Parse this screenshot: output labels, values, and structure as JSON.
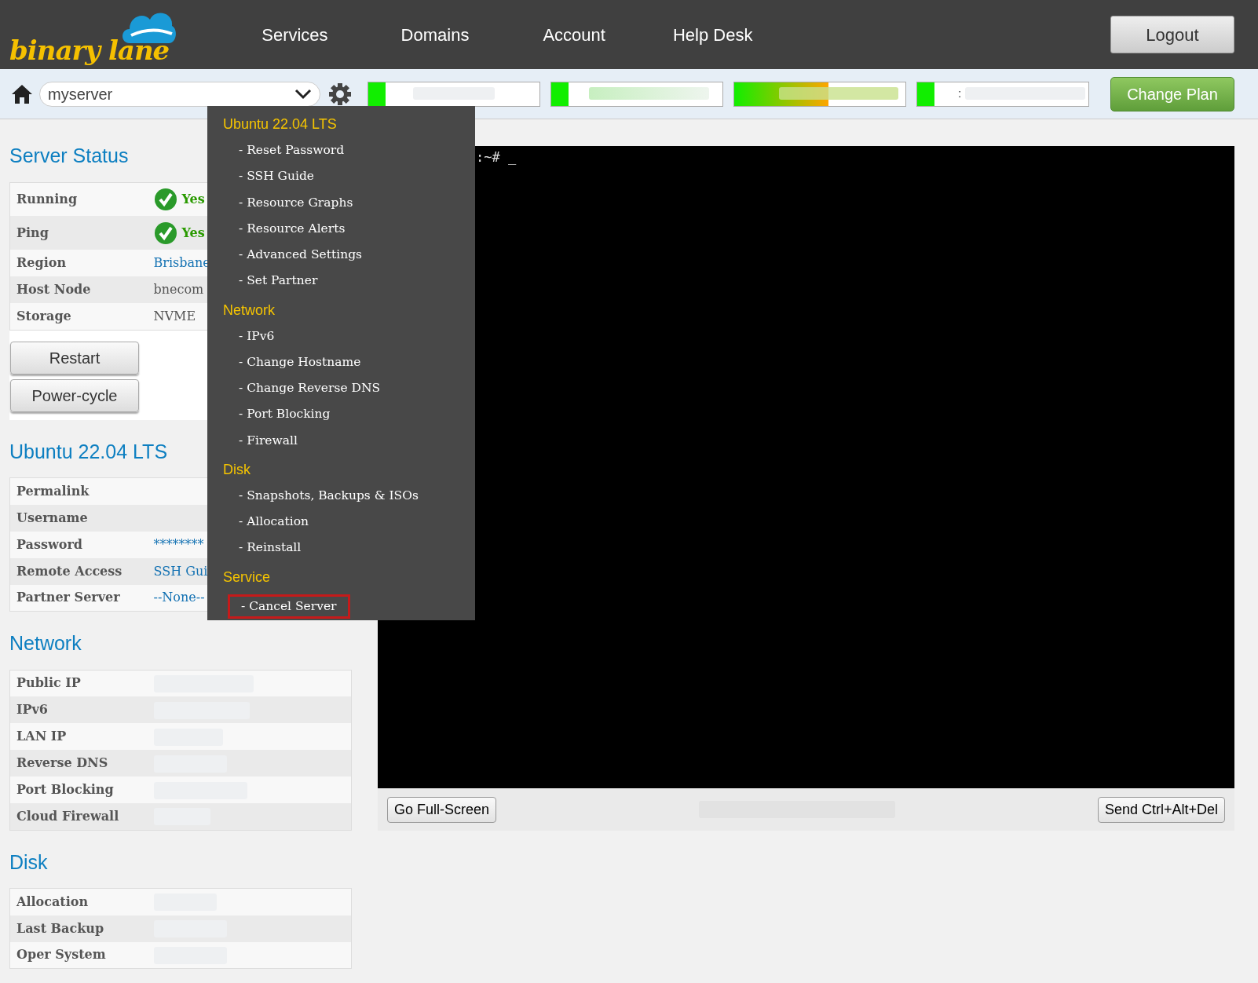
{
  "header": {
    "logo": "binary lane",
    "nav": [
      "Services",
      "Domains",
      "Account",
      "Help Desk"
    ],
    "logout": "Logout"
  },
  "toolbar": {
    "server": "myserver",
    "meters": [
      {
        "level": 0.1
      },
      {
        "level": 0.1
      },
      {
        "level": 0.55
      },
      {
        "level": 0.1,
        "text": ":"
      }
    ],
    "change_plan": "Change Plan"
  },
  "sections": [
    {
      "title": "Server Status",
      "rows": [
        {
          "label": "Running",
          "kind": "status",
          "value": "Yes"
        },
        {
          "label": "Ping",
          "kind": "status",
          "value": "Yes"
        },
        {
          "label": "Region",
          "kind": "link",
          "value": "Brisbane"
        },
        {
          "label": "Host Node",
          "kind": "text",
          "value": "bnecom"
        },
        {
          "label": "Storage",
          "kind": "text",
          "value": "NVME"
        }
      ],
      "buttons": [
        "Restart",
        "Power-cycle"
      ]
    },
    {
      "title": "Ubuntu 22.04 LTS",
      "rows": [
        {
          "label": "Permalink",
          "kind": "empty"
        },
        {
          "label": "Username",
          "kind": "empty"
        },
        {
          "label": "Password",
          "kind": "link",
          "value": "********"
        },
        {
          "label": "Remote Access",
          "kind": "link",
          "value": "SSH Gui"
        },
        {
          "label": "Partner Server",
          "kind": "link",
          "value": "--None--"
        }
      ]
    },
    {
      "title": "Network",
      "rows": [
        {
          "label": "Public IP",
          "kind": "blurred"
        },
        {
          "label": "IPv6",
          "kind": "blurred"
        },
        {
          "label": "LAN IP",
          "kind": "blurred"
        },
        {
          "label": "Reverse DNS",
          "kind": "blurred"
        },
        {
          "label": "Port Blocking",
          "kind": "blurred"
        },
        {
          "label": "Cloud Firewall",
          "kind": "blurred"
        }
      ]
    },
    {
      "title": "Disk",
      "rows": [
        {
          "label": "Allocation",
          "kind": "blurred"
        },
        {
          "label": "Last Backup",
          "kind": "blurred"
        },
        {
          "label": "Oper System",
          "kind": "blurred"
        }
      ]
    }
  ],
  "menu": [
    {
      "heading": "Ubuntu 22.04 LTS",
      "items": [
        {
          "label": "- Reset Password",
          "highlighted": false
        },
        {
          "label": "- SSH Guide",
          "highlighted": false
        },
        {
          "label": "- Resource Graphs",
          "highlighted": false
        },
        {
          "label": "- Resource Alerts",
          "highlighted": false
        },
        {
          "label": "- Advanced Settings",
          "highlighted": false
        },
        {
          "label": "- Set Partner",
          "highlighted": false
        }
      ]
    },
    {
      "heading": "Network",
      "items": [
        {
          "label": "- IPv6",
          "highlighted": false
        },
        {
          "label": "- Change Hostname",
          "highlighted": false
        },
        {
          "label": "- Change Reverse DNS",
          "highlighted": false
        },
        {
          "label": "- Port Blocking",
          "highlighted": false
        },
        {
          "label": "- Firewall",
          "highlighted": false
        }
      ]
    },
    {
      "heading": "Disk",
      "items": [
        {
          "label": "- Snapshots, Backups & ISOs",
          "highlighted": false
        },
        {
          "label": "- Allocation",
          "highlighted": false
        },
        {
          "label": "- Reinstall",
          "highlighted": false
        }
      ]
    },
    {
      "heading": "Service",
      "items": [
        {
          "label": "- Cancel Server",
          "highlighted": true
        }
      ]
    }
  ],
  "console": {
    "prompt": ":~# _",
    "fullscreen": "Go Full-Screen",
    "ctrl_alt_del": "Send Ctrl+Alt+Del"
  }
}
